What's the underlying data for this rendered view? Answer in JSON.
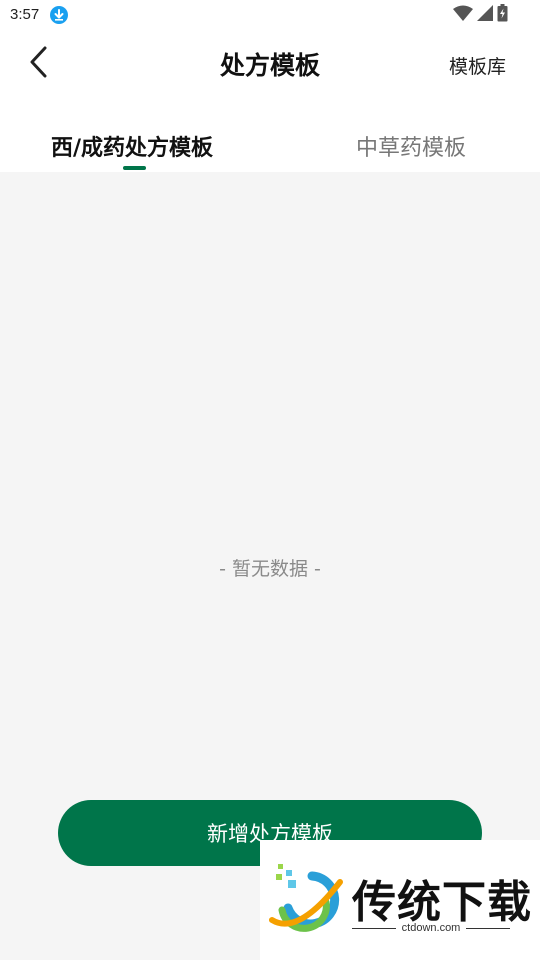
{
  "status_bar": {
    "time": "3:57",
    "icons": [
      "download-icon",
      "wifi-icon",
      "signal-icon",
      "battery-icon"
    ]
  },
  "header": {
    "back_icon": "chevron-left-icon",
    "title": "处方模板",
    "right_link": "模板库"
  },
  "tabs": [
    {
      "label": "西/成药处方模板",
      "active": true
    },
    {
      "label": "中草药模板",
      "active": false
    }
  ],
  "content": {
    "empty_text": "- 暂无数据 -"
  },
  "add_button": {
    "label": "新增处方模板"
  },
  "watermark": {
    "title": "传统下载",
    "subtitle": "ctdown.com"
  },
  "colors": {
    "accent": "#00754a",
    "content_bg": "#f5f5f5",
    "status_download": "#1aa0f0"
  }
}
